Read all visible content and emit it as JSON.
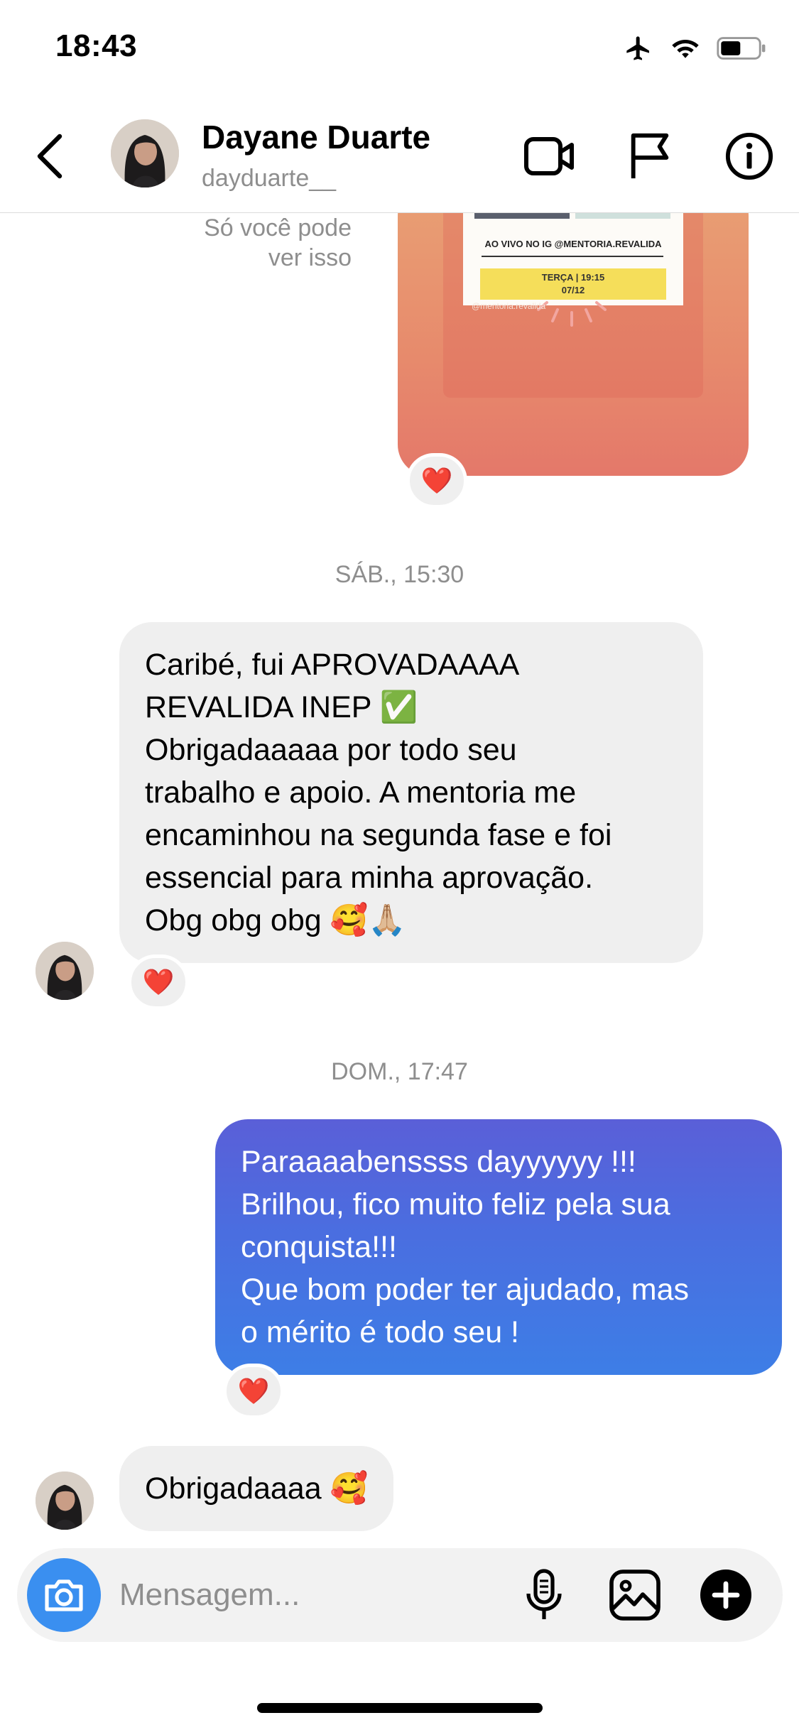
{
  "status_bar": {
    "time": "18:43",
    "icons": [
      "airplane-icon",
      "wifi-icon",
      "battery-icon"
    ]
  },
  "header": {
    "name": "Dayane Duarte",
    "username": "dayduarte__",
    "actions": [
      "video-call-icon",
      "flag-icon",
      "info-icon"
    ]
  },
  "chat": {
    "only_you_note": [
      "Só você pode",
      "ver isso"
    ],
    "story_flyer": {
      "line": "AO VIVO NO IG @MENTORIA.REVALIDA",
      "date_line1": "TERÇA | 19:15",
      "date_line2": "07/12",
      "handle": "@mentoria.revalida"
    },
    "reaction_emoji": "❤️",
    "timestamp_1": "SÁB., 15:30",
    "message_1_lines": [
      "Caribé, fui APROVADAAAA",
      "REVALIDA INEP ✅",
      "Obrigadaaaaa por todo seu",
      "trabalho e apoio. A mentoria me",
      "encaminhou na segunda fase e foi",
      "essencial para minha aprovação.",
      "Obg obg obg 🥰🙏🏼"
    ],
    "timestamp_2": "DOM., 17:47",
    "message_2_lines": [
      "Paraaaabenssss dayyyyyy !!!",
      "Brilhou, fico muito feliz pela sua",
      "conquista!!!",
      "Que bom poder ter ajudado, mas",
      "o mérito é todo seu !"
    ],
    "message_3": "Obrigadaaaa 🥰"
  },
  "composer": {
    "placeholder": "Mensagem...",
    "icons": [
      "camera-icon",
      "microphone-icon",
      "gallery-icon",
      "plus-icon"
    ]
  },
  "colors": {
    "outgoing_bubble_top": "#5a5fd8",
    "outgoing_bubble_bottom": "#3d7ee6",
    "incoming_bubble": "#efefef",
    "camera_button": "#3a8ff0"
  }
}
